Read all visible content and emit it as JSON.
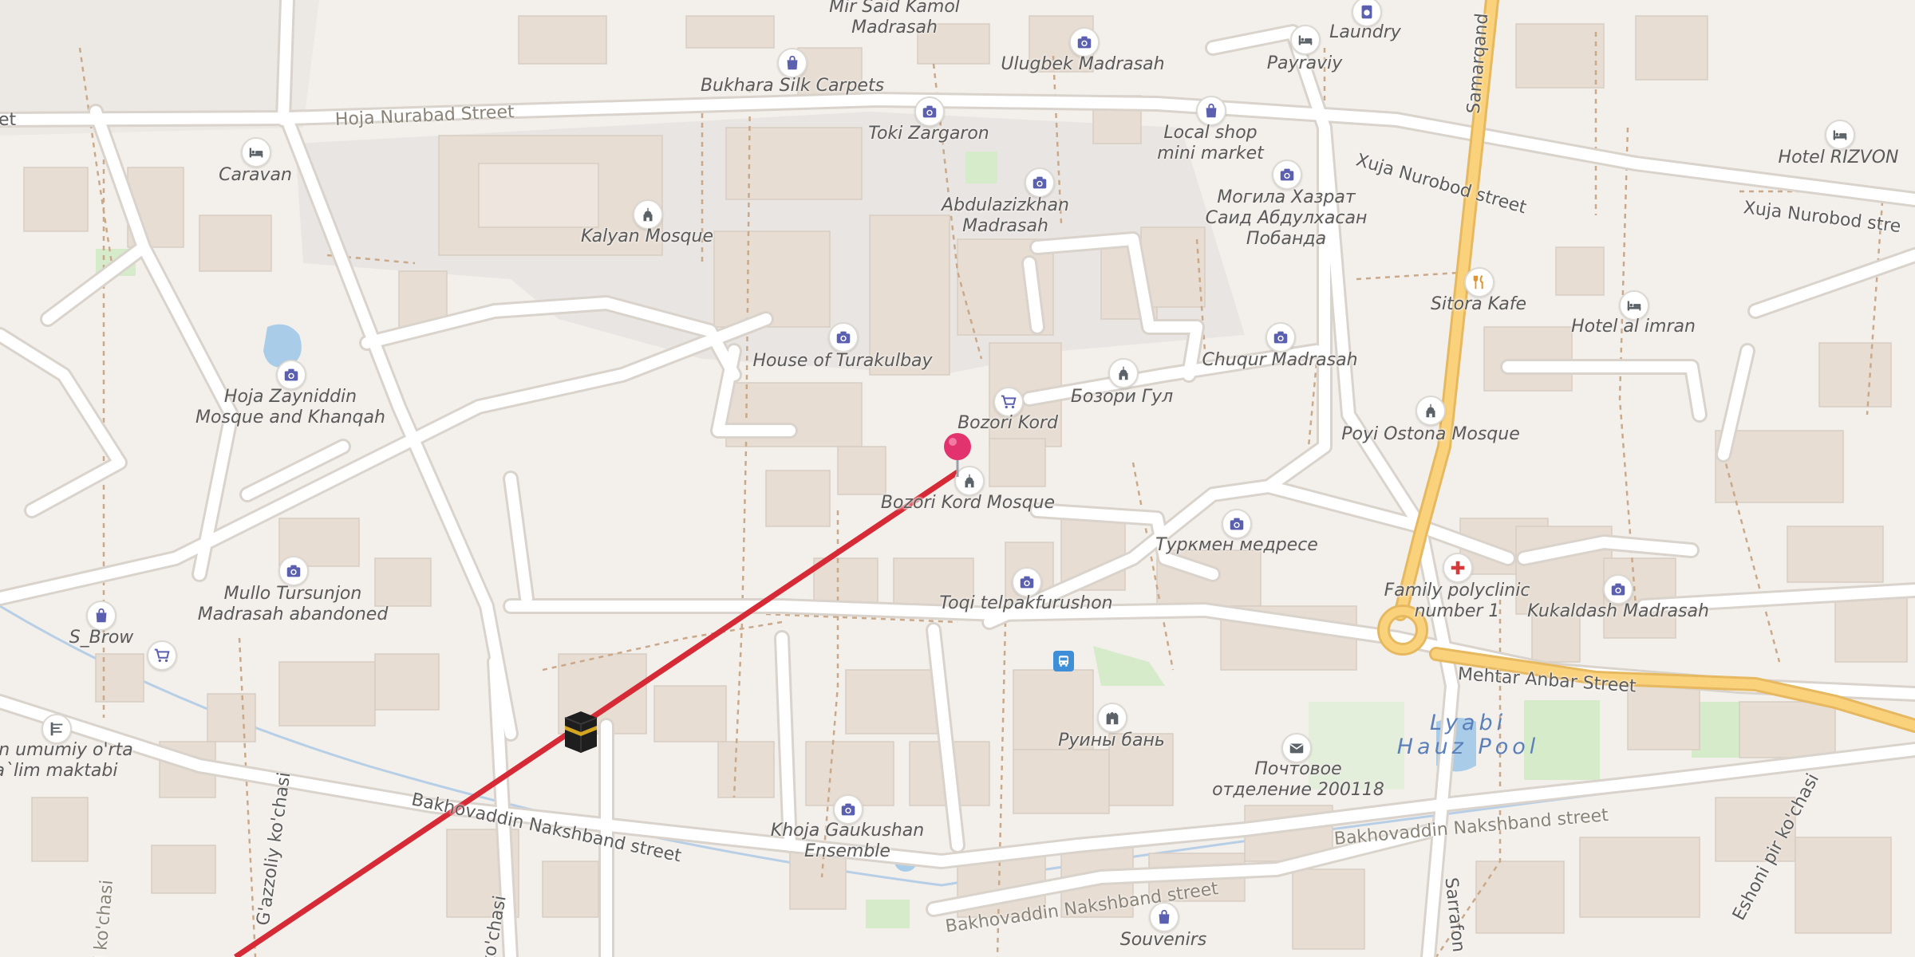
{
  "map": {
    "pois": [
      {
        "name": "Mir Said Kamol\nMadrasah",
        "icon": "camera-icon"
      },
      {
        "name": "Laundry",
        "icon": "laundry-icon"
      },
      {
        "name": "Ulugbek Madrasah",
        "icon": "camera-icon"
      },
      {
        "name": "Bukhara Silk Carpets",
        "icon": "shopping-bag-icon"
      },
      {
        "name": "Payraviy",
        "icon": "hotel-icon"
      },
      {
        "name": "Toki Zargaron",
        "icon": "camera-icon"
      },
      {
        "name": "Local shop\nmini market",
        "icon": "shopping-bag-icon"
      },
      {
        "name": "Caravan",
        "icon": "hotel-icon"
      },
      {
        "name": "Hotel RIZVON",
        "icon": "hotel-icon"
      },
      {
        "name": "Abdulazizkhan\nMadrasah",
        "icon": "camera-icon"
      },
      {
        "name": "Могила Хазрат\nСаид Абдулхасан\nПобанда",
        "icon": "camera-icon"
      },
      {
        "name": "Kalyan Mosque",
        "icon": "mosque-icon"
      },
      {
        "name": "Sitora Kafe",
        "icon": "restaurant-icon"
      },
      {
        "name": "Hotel al imran",
        "icon": "hotel-icon"
      },
      {
        "name": "House of Turakulbay",
        "icon": "camera-icon"
      },
      {
        "name": "Chuqur Madrasah",
        "icon": "camera-icon"
      },
      {
        "name": "Hoja Zayniddin\nMosque and Khanqah",
        "icon": "camera-icon"
      },
      {
        "name": "Бозори Гул",
        "icon": "mosque-icon"
      },
      {
        "name": "Bozori Kord",
        "icon": "cart-icon"
      },
      {
        "name": "Poyi Ostona Mosque",
        "icon": "mosque-icon"
      },
      {
        "name": "Bozori Kord Mosque",
        "icon": "mosque-icon"
      },
      {
        "name": "Туркмен медресе",
        "icon": "camera-icon"
      },
      {
        "name": "Family polyclinic\nnumber 1",
        "icon": "medical-cross-icon"
      },
      {
        "name": "Mullo Tursunjon\nMadrasah abandoned",
        "icon": "camera-icon"
      },
      {
        "name": "Toqi telpakfurushon",
        "icon": "camera-icon"
      },
      {
        "name": "Kukaldash Madrasah",
        "icon": "camera-icon"
      },
      {
        "name": "S_Brow",
        "icon": "shopping-bag-icon"
      },
      {
        "name": "",
        "icon": "cart-icon"
      },
      {
        "name": "",
        "icon": "bus-stop-icon"
      },
      {
        "name": "Руины бань",
        "icon": "ruins-icon"
      },
      {
        "name": "son umumiy o'rta\na`lim maktabi",
        "icon": "school-icon"
      },
      {
        "name": "Почтовое\nотделение 200118",
        "icon": "post-office-icon"
      },
      {
        "name": "Khoja Gaukushan\nEnsemble",
        "icon": "camera-icon"
      },
      {
        "name": "Souvenirs",
        "icon": "shopping-bag-icon"
      },
      {
        "name": "",
        "icon": "kaaba-icon"
      }
    ],
    "streets": [
      "Hoja Nurabad Street",
      "Xuja Nurobod street",
      "Xuja Nurobod stre",
      "Samarqand",
      "Mehtar Anbar Street",
      "Bakhovaddin Nakshband street",
      "Bakhovaddin Nakshband street",
      "Bakhovaddin Nakshband street",
      "G'azzoliy ko'chasi",
      "ko'chasi",
      "d ko'chasi",
      "Sarrafon k",
      "Eshoni pir ko'chasi",
      "et"
    ],
    "water_label": "Lyabi\nHauz Pool",
    "pin_marker": "location-pin-icon",
    "colors": {
      "background": "#f3f0ec",
      "building": "#e7ddd3",
      "road": "#ffffff",
      "major_road": "#fbd27c",
      "route_line": "#d62a36",
      "pin": "#e2336e",
      "poi_icon": "#5b5fb0",
      "water": "#a9cce8",
      "park": "#d6ebc9"
    }
  }
}
